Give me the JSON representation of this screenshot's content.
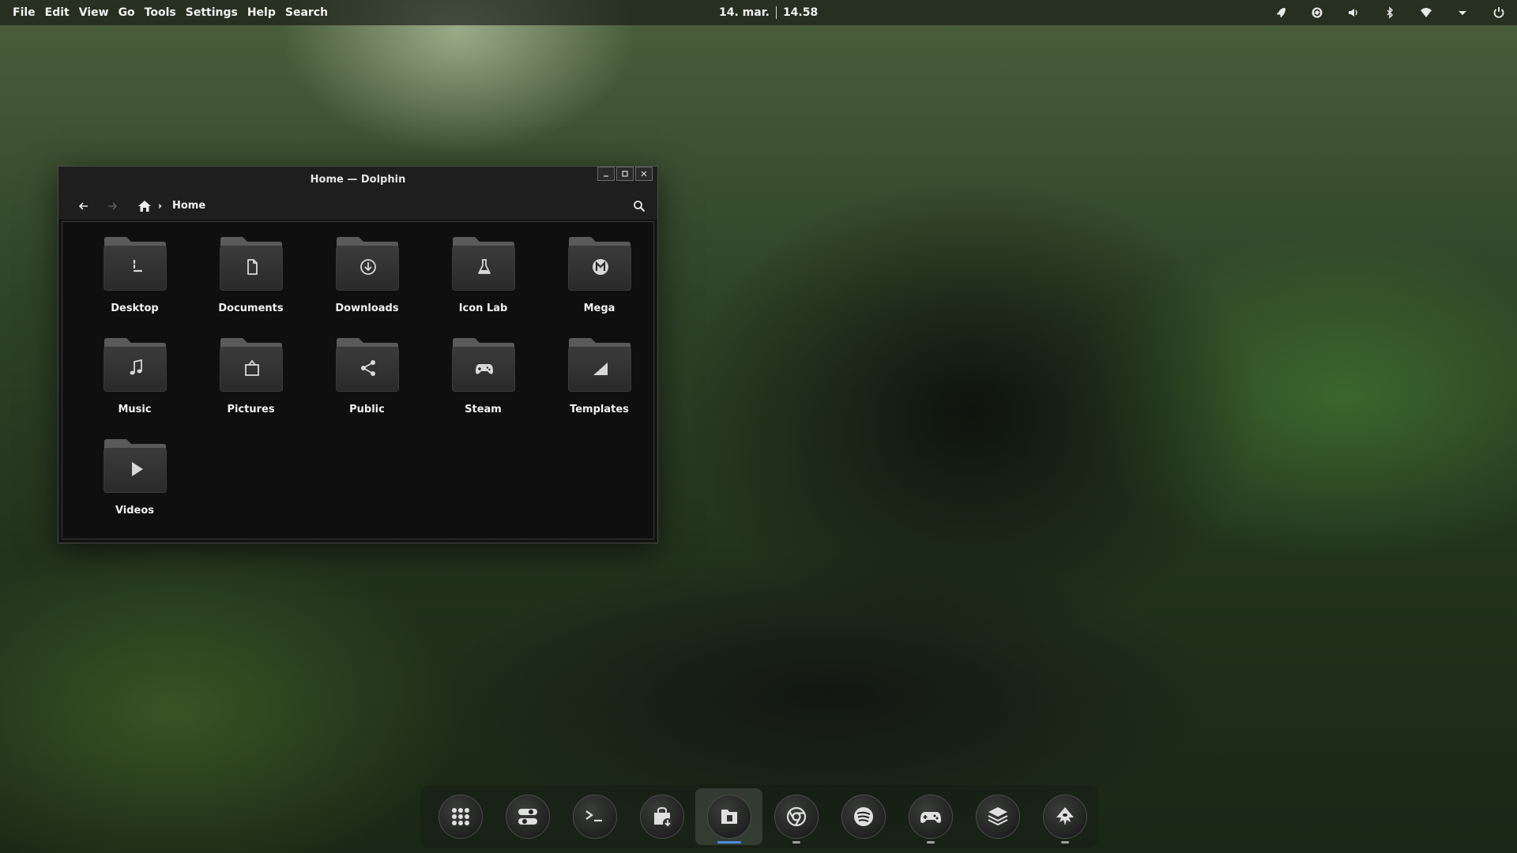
{
  "menubar": {
    "items": [
      {
        "label": "File"
      },
      {
        "label": "Edit"
      },
      {
        "label": "View"
      },
      {
        "label": "Go"
      },
      {
        "label": "Tools"
      },
      {
        "label": "Settings"
      },
      {
        "label": "Help"
      },
      {
        "label": "Search"
      }
    ]
  },
  "clock": {
    "date": "14. mar.",
    "time": "14.58"
  },
  "tray": {
    "icons": [
      "rocket-icon",
      "sync-icon",
      "volume-icon",
      "bluetooth-icon",
      "wifi-icon",
      "arrow-down-icon",
      "power-icon"
    ]
  },
  "window": {
    "title": "Home — Dolphin",
    "breadcrumb": {
      "current": "Home"
    },
    "folders": [
      {
        "name": "Desktop",
        "icon": "desktop-glyph"
      },
      {
        "name": "Documents",
        "icon": "document-glyph"
      },
      {
        "name": "Downloads",
        "icon": "download-glyph"
      },
      {
        "name": "Icon Lab",
        "icon": "flask-glyph"
      },
      {
        "name": "Mega",
        "icon": "mega-glyph"
      },
      {
        "name": "Music",
        "icon": "music-glyph"
      },
      {
        "name": "Pictures",
        "icon": "picture-glyph"
      },
      {
        "name": "Public",
        "icon": "share-glyph"
      },
      {
        "name": "Steam",
        "icon": "gamepad-glyph"
      },
      {
        "name": "Templates",
        "icon": "template-glyph"
      },
      {
        "name": "Videos",
        "icon": "play-glyph"
      }
    ]
  },
  "dock": {
    "items": [
      {
        "name": "app-grid",
        "running": false,
        "active": false
      },
      {
        "name": "settings-toggle",
        "running": false,
        "active": false
      },
      {
        "name": "terminal",
        "running": false,
        "active": false
      },
      {
        "name": "software-store",
        "running": false,
        "active": false
      },
      {
        "name": "files",
        "running": true,
        "active": true
      },
      {
        "name": "chrome",
        "running": true,
        "active": false
      },
      {
        "name": "spotify",
        "running": false,
        "active": false
      },
      {
        "name": "steam-gamepad",
        "running": true,
        "active": false
      },
      {
        "name": "layers",
        "running": false,
        "active": false
      },
      {
        "name": "inkscape",
        "running": true,
        "active": false
      }
    ]
  }
}
